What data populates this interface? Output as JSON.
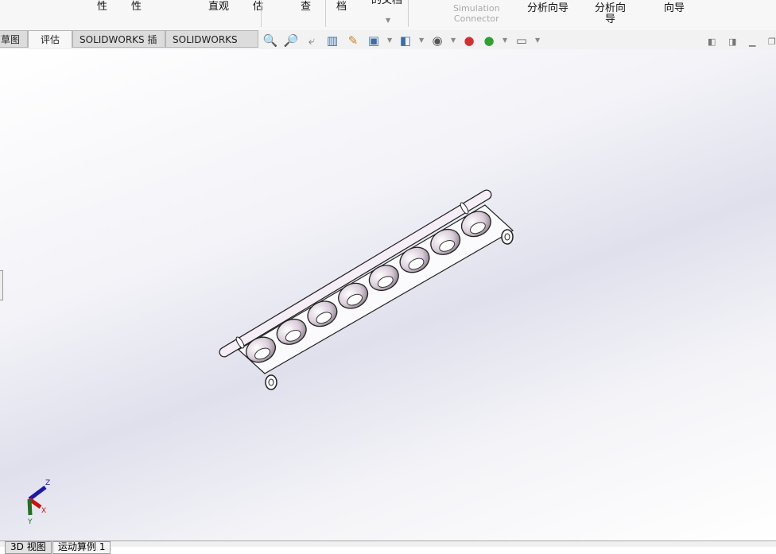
{
  "ribbon": {
    "labels": [
      "性",
      "性",
      "直观",
      "估",
      "查",
      "档",
      "的文档"
    ],
    "simulation_connector": [
      "Simulation",
      "Connector"
    ],
    "wizards": [
      "分析向导",
      "分析向",
      "导",
      "向导"
    ]
  },
  "tabs": [
    {
      "label": "草图",
      "active": false
    },
    {
      "label": "评估",
      "active": true
    },
    {
      "label": "SOLIDWORKS 插件",
      "active": false
    },
    {
      "label": "SOLIDWORKS MBD",
      "active": false
    }
  ],
  "view_tools": [
    "zoom-to-fit-icon",
    "zoom-to-area-icon",
    "previous-view-icon",
    "section-view-icon",
    "dynamic-annotation-icon",
    "view-orientation-icon",
    "display-style-icon",
    "hide-show-icon",
    "edit-appearance-icon",
    "apply-scene-icon",
    "view-settings-icon"
  ],
  "bottom_tabs": [
    "3D 视图",
    "运动算例 1"
  ],
  "triad": {
    "x": "X",
    "y": "Y",
    "z": "Z"
  },
  "colors": {
    "x_axis": "#d01010",
    "y_axis": "#207020",
    "z_axis": "#1a1aa8"
  }
}
